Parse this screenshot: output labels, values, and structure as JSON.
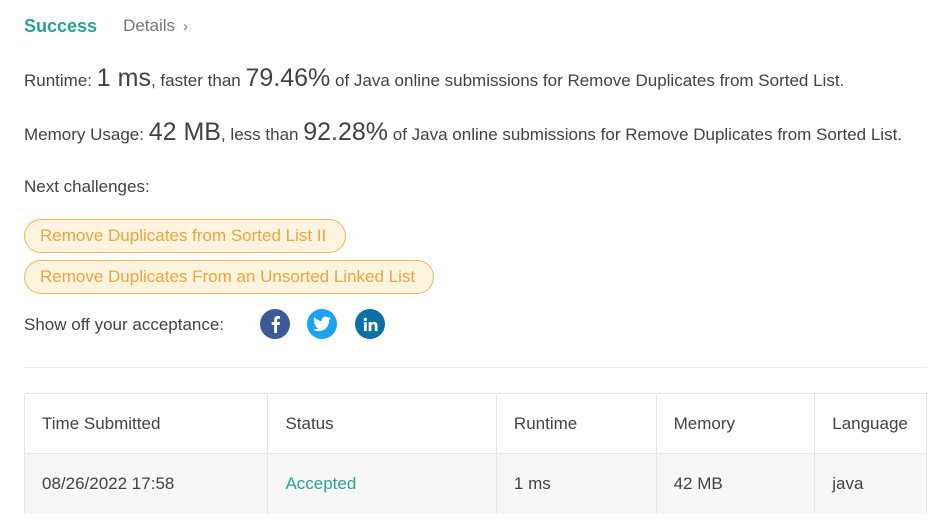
{
  "header": {
    "status": "Success",
    "details_label": "Details",
    "details_chevron": "›"
  },
  "runtime": {
    "label": "Runtime:",
    "value": "1 ms",
    "mid": ", faster than",
    "percent": "79.46%",
    "suffix": "of Java online submissions for Remove Duplicates from Sorted List."
  },
  "memory": {
    "label": "Memory Usage:",
    "value": "42 MB",
    "mid": ", less than",
    "percent": "92.28%",
    "suffix": "of Java online submissions for Remove Duplicates from Sorted List."
  },
  "next_challenges": {
    "label": "Next challenges:",
    "items": [
      "Remove Duplicates from Sorted List II",
      "Remove Duplicates From an Unsorted Linked List"
    ]
  },
  "share": {
    "label": "Show off your acceptance:",
    "icons": [
      "facebook-icon",
      "twitter-icon",
      "linkedin-icon"
    ]
  },
  "table": {
    "headers": [
      "Time Submitted",
      "Status",
      "Runtime",
      "Memory",
      "Language"
    ],
    "rows": [
      [
        "08/26/2022 17:58",
        "Accepted",
        "1 ms",
        "42 MB",
        "java"
      ]
    ]
  },
  "colors": {
    "accent": "#2aa391",
    "chip_text": "#f0a43d",
    "chip_border": "#f9b455",
    "chip_bg": "#fff4e0",
    "facebook": "#3a5a98",
    "twitter": "#1da1f2",
    "linkedin": "#0e6fa8"
  }
}
